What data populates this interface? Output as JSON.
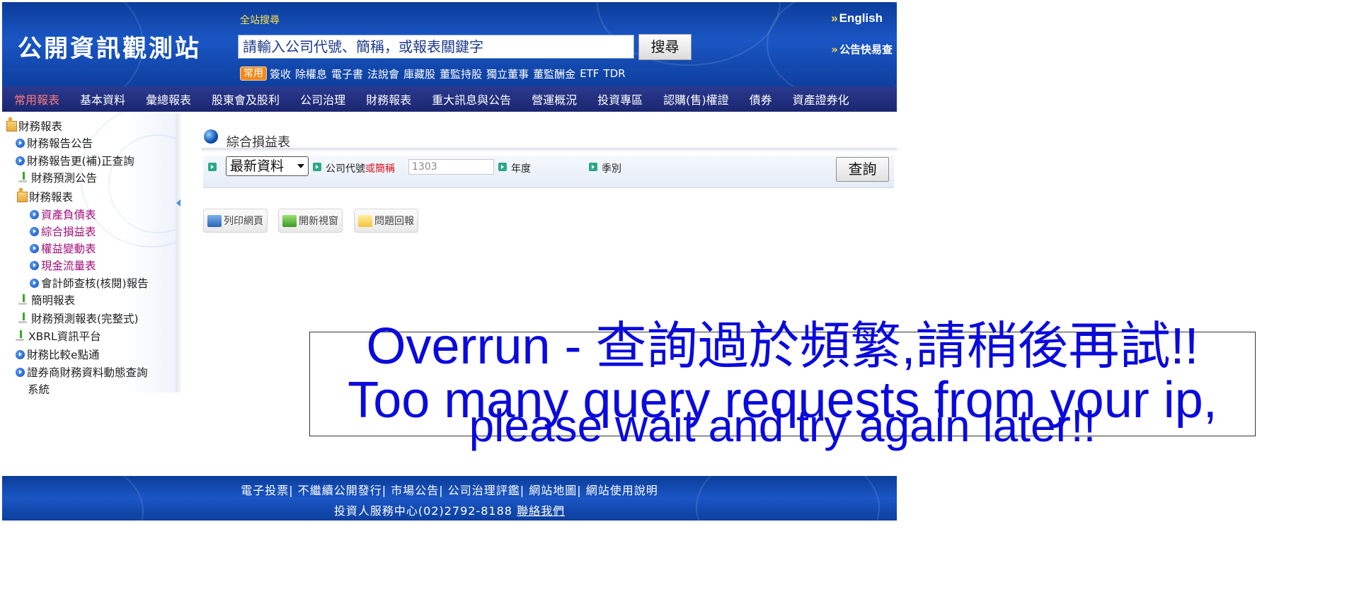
{
  "header": {
    "logo_text": "公開資訊觀測站",
    "search_title": "全站搜尋",
    "search_placeholder": "請輸入公司代號、簡稱，或報表關鍵字",
    "search_button": "搜尋",
    "common_badge": "常用",
    "quick_links": [
      "簽收",
      "除權息",
      "電子書",
      "法說會",
      "庫藏股",
      "董監持股",
      "獨立董事",
      "董監酬金",
      "ETF",
      "TDR"
    ],
    "lang_link": "English",
    "announce_link": "公告快易查"
  },
  "nav": {
    "items": [
      "常用報表",
      "基本資料",
      "彙總報表",
      "股東會及股利",
      "公司治理",
      "財務報表",
      "重大訊息與公告",
      "營運概況",
      "投資專區",
      "認購(售)權證",
      "債券",
      "資產證券化"
    ],
    "active_index": 0
  },
  "sidebar": {
    "items": [
      {
        "label": "財務報表",
        "icon": "folder-icon"
      },
      {
        "label": "財務報告公告",
        "icon": "bullet-icon"
      },
      {
        "label": "財務報告更(補)正查詢",
        "icon": "bullet-icon"
      },
      {
        "label": "財務預測公告",
        "icon": "download-icon"
      },
      {
        "label": "財務報表",
        "icon": "folder-icon"
      },
      {
        "label": "資產負債表",
        "icon": "bullet-icon"
      },
      {
        "label": "綜合損益表",
        "icon": "bullet-icon"
      },
      {
        "label": "權益變動表",
        "icon": "bullet-icon"
      },
      {
        "label": "現金流量表",
        "icon": "bullet-icon"
      },
      {
        "label": "會計師查核(核閱)報告",
        "icon": "bullet-icon"
      },
      {
        "label": "簡明報表",
        "icon": "download-icon"
      },
      {
        "label": "財務預測報表(完整式)",
        "icon": "download-icon"
      },
      {
        "label": "XBRL資訊平台",
        "icon": "download-icon"
      },
      {
        "label": "財務比較e點通",
        "icon": "bullet-icon"
      },
      {
        "label": "證券商財務資料動態查詢",
        "icon": "bullet-icon"
      },
      {
        "label": "系統",
        "icon": ""
      }
    ]
  },
  "main": {
    "title": "綜合損益表",
    "query": {
      "data_select": "最新資料",
      "company_label": "公司代號",
      "company_label_alt": "或簡稱",
      "company_value": "1303",
      "year_label": "年度",
      "season_label": "季別",
      "query_button": "查詢"
    },
    "tools": {
      "print": "列印網頁",
      "new_window": "開新視窗",
      "feedback": "問題回報"
    }
  },
  "overrun": {
    "line1_prefix": "Overrun - ",
    "line1_zh": "查詢過於頻繁,請稍後再試!!",
    "line2": "Too many query requests from your ip,",
    "line3": "please wait and try again later!!"
  },
  "footer": {
    "links": [
      "電子投票",
      "不繼續公開發行",
      "市場公告",
      "公司治理評鑑",
      "網站地圖",
      "網站使用說明"
    ],
    "contact_text": "投資人服務中心(02)2792-8188",
    "contact_link": "聯絡我們"
  },
  "colors": {
    "header_blue": "#1a56c4",
    "nav_navy": "#1b2670",
    "active_nav": "#ff7b7b",
    "overrun_blue": "#0a0add",
    "sidebar_pink": "#a0107a"
  }
}
